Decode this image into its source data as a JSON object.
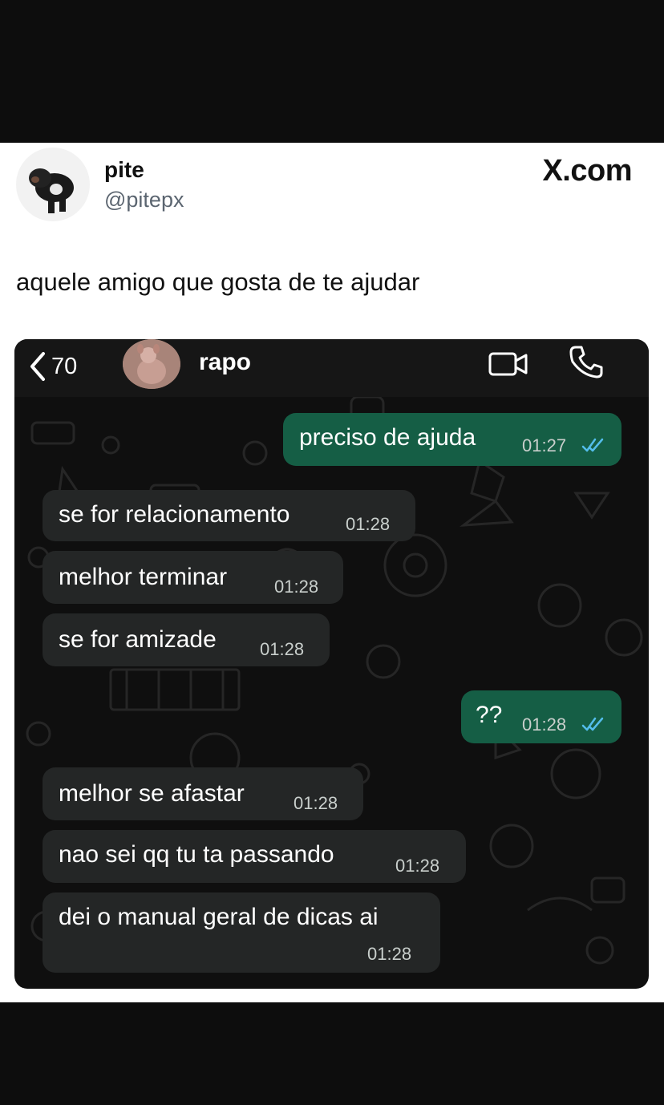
{
  "tweet": {
    "display_name": "pite",
    "handle": "@pitepx",
    "brand": "X.com",
    "text": "aquele amigo que gosta de te ajudar"
  },
  "chat": {
    "back_count": "70",
    "contact_name": "rapo",
    "header_icons": [
      "video-call-icon",
      "phone-call-icon"
    ],
    "colors": {
      "incoming_bubble": "#242626",
      "outgoing_bubble": "#155e45",
      "read_tick": "#53bdeb"
    },
    "messages": [
      {
        "direction": "outgoing",
        "text": "preciso de ajuda",
        "time": "01:27",
        "status": "read"
      },
      {
        "direction": "incoming",
        "text": "se for relacionamento",
        "time": "01:28"
      },
      {
        "direction": "incoming",
        "text": "melhor terminar",
        "time": "01:28"
      },
      {
        "direction": "incoming",
        "text": "se for amizade",
        "time": "01:28"
      },
      {
        "direction": "outgoing",
        "text": "??",
        "time": "01:28",
        "status": "read"
      },
      {
        "direction": "incoming",
        "text": "melhor se afastar",
        "time": "01:28"
      },
      {
        "direction": "incoming",
        "text": "nao sei qq tu ta passando",
        "time": "01:28"
      },
      {
        "direction": "incoming",
        "text": "dei o manual geral de dicas ai",
        "time": "01:28"
      }
    ]
  }
}
